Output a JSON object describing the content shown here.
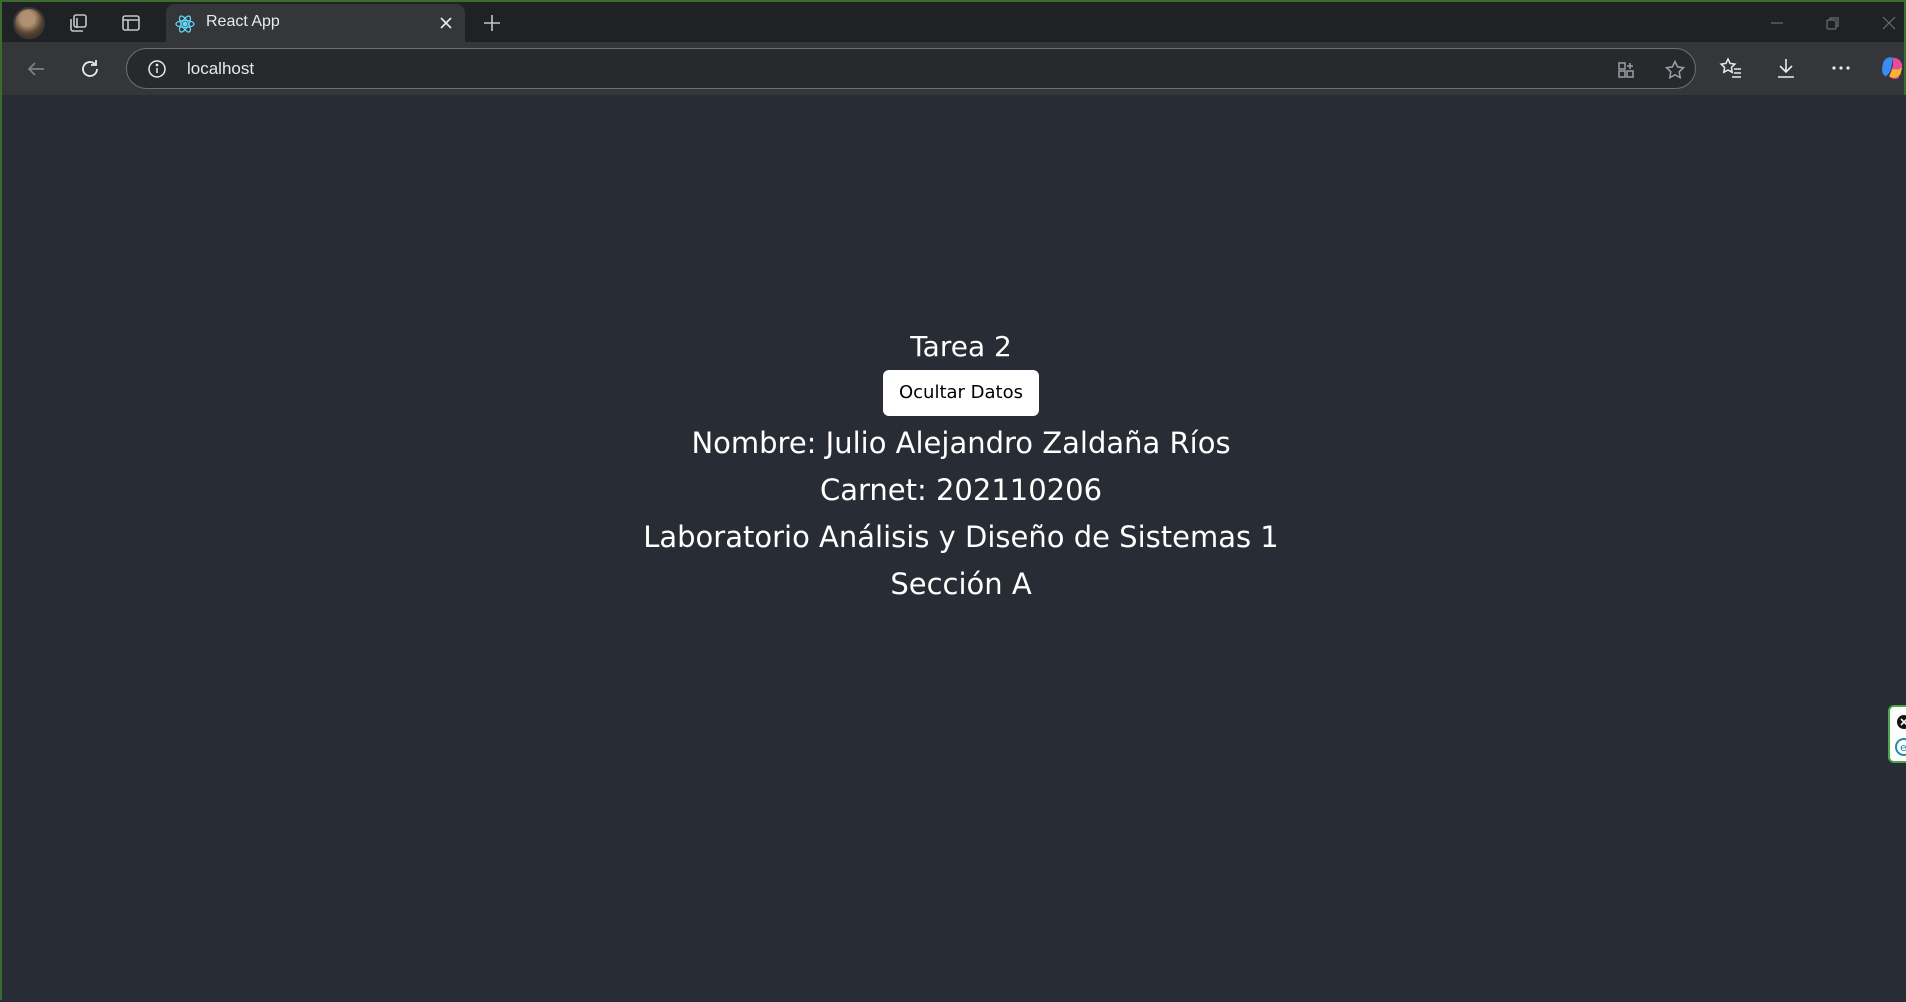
{
  "browser": {
    "tab": {
      "title": "React App",
      "favicon": "react-logo-icon"
    },
    "address_bar": {
      "url": "localhost"
    }
  },
  "page": {
    "heading": "Tarea 2",
    "toggle_button_label": "Ocultar Datos",
    "lines": [
      "Nombre: Julio Alejandro Zaldaña Ríos",
      "Carnet: 202110206",
      "Laboratorio Análisis y Diseño de Sistemas 1",
      "Sección A"
    ]
  },
  "colors": {
    "page_background": "#282c34",
    "text": "#ffffff",
    "button_background": "#ffffff"
  }
}
